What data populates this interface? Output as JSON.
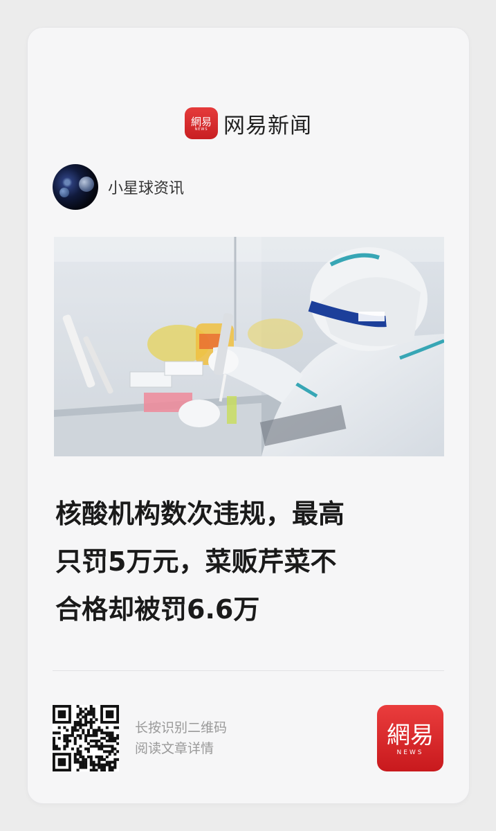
{
  "brand": {
    "logo_text": "網易",
    "logo_subtext": "NEWS",
    "name": "网易新闻"
  },
  "author": {
    "name": "小星球资讯"
  },
  "article": {
    "image_alt": "lab worker in protective suit and face shield pipetting samples in a biosafety cabinet",
    "headline_lines": [
      "核酸机构数次违规，最高",
      "只罚5万元，菜贩芹菜不",
      "合格却被罚6.6万"
    ]
  },
  "footer": {
    "hint_line1": "长按识别二维码",
    "hint_line2": "阅读文章详情",
    "logo_text": "網易",
    "logo_subtext": "NEWS"
  },
  "colors": {
    "brand_red": "#d72a2c",
    "headline": "#1a1a1a",
    "hint": "#999999"
  }
}
